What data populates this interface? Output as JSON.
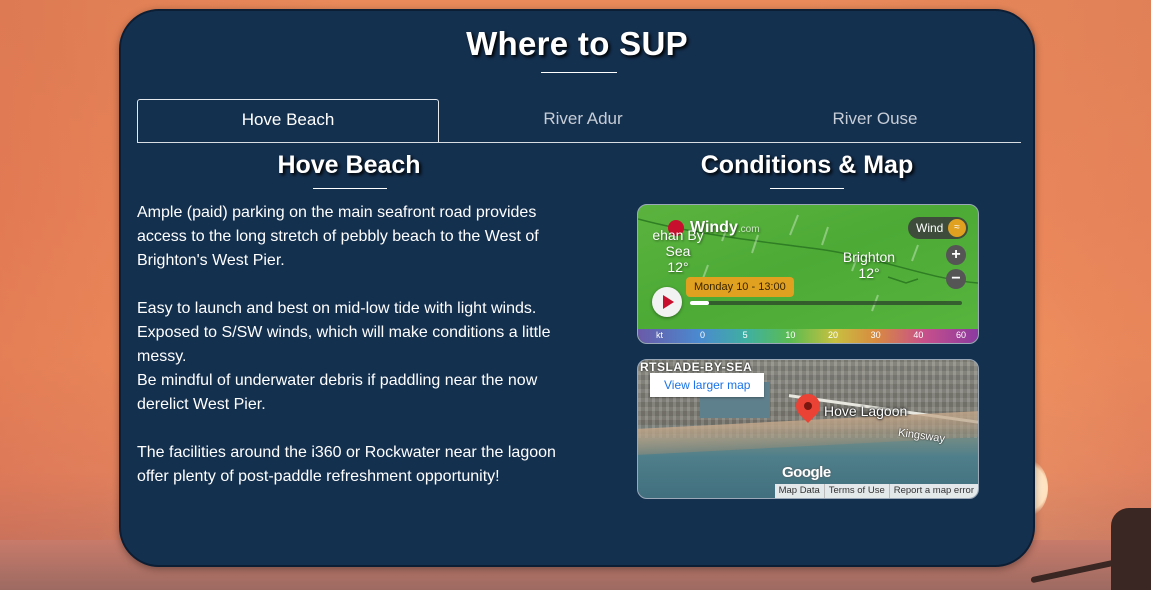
{
  "page": {
    "title": "Where to SUP"
  },
  "tabs": [
    {
      "label": "Hove Beach",
      "active": true
    },
    {
      "label": "River Adur",
      "active": false
    },
    {
      "label": "River Ouse",
      "active": false
    }
  ],
  "left_panel": {
    "heading": "Hove Beach",
    "paragraphs": [
      "Ample (paid) parking on the main seafront road provides access to the long stretch of pebbly beach to the West of Brighton's West Pier.",
      "Easy to launch and best on mid-low tide with light winds. Exposed to S/SW winds, which will make conditions a little messy.",
      "Be mindful of underwater debris if paddling near the now derelict West Pier.",
      "The facilities around the i360 or Rockwater near the lagoon offer plenty of post-paddle refreshment opportunity!"
    ]
  },
  "right_panel": {
    "heading": "Conditions & Map",
    "windy": {
      "logo": "Windy",
      "logo_suffix": ".com",
      "place_left": "ehan By Sea",
      "place_left_temp": "12°",
      "place_right": "Brighton",
      "place_right_temp": "12°",
      "layer_label": "Wind",
      "zoom_in": "+",
      "zoom_out": "−",
      "time_label": "Monday 10 - 13:00",
      "timeline_progress": 0.07,
      "scale_unit": "kt",
      "scale_ticks": [
        "0",
        "5",
        "10",
        "20",
        "30",
        "40",
        "60"
      ]
    },
    "map": {
      "area_label": "RTSLADE-BY-SEA",
      "view_larger": "View larger map",
      "pin_label": "Hove Lagoon",
      "road_label": "Kingsway",
      "provider": "Google",
      "attribution": [
        "Map Data",
        "Terms of Use",
        "Report a map error"
      ]
    }
  }
}
